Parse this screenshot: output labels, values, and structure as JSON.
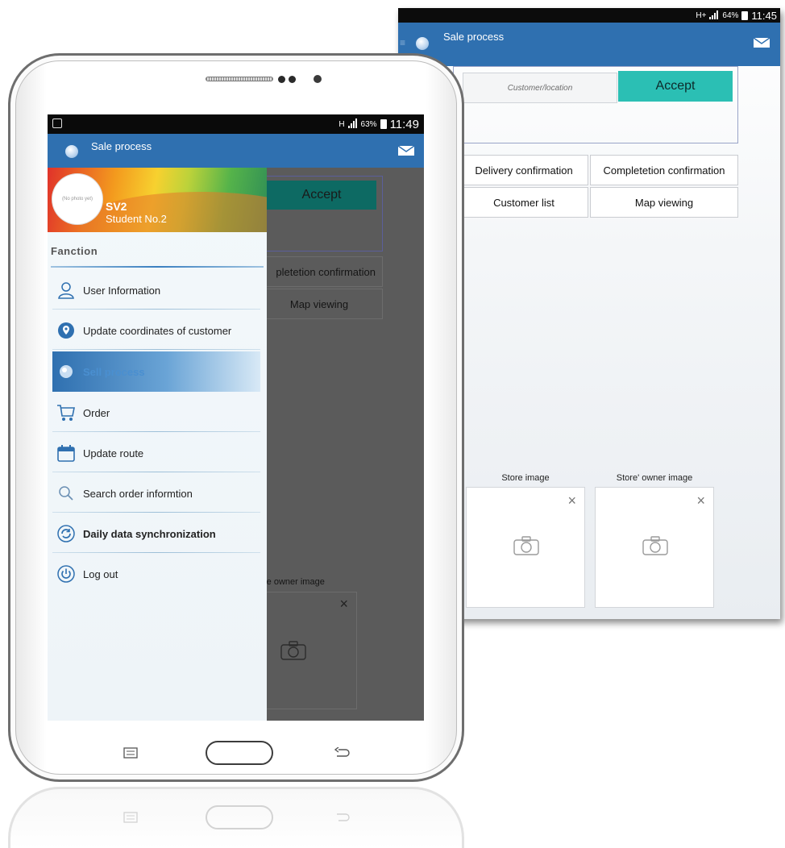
{
  "back_screen": {
    "status": {
      "signal_label": "H+",
      "battery": "64%",
      "time": "11:45"
    },
    "app_title": "Sale process",
    "location_placeholder": "Customer/location",
    "accept_label": "Accept",
    "buttons": [
      {
        "label": "Delivery confirmation"
      },
      {
        "label": "Completetion confirmation"
      },
      {
        "label": "Customer list"
      },
      {
        "label": "Map viewing"
      }
    ],
    "images": [
      {
        "label": "Store image"
      },
      {
        "label": "Store' owner image"
      }
    ],
    "close_glyph": "×"
  },
  "tablet": {
    "status": {
      "signal_label": "H",
      "battery": "63%",
      "time": "11:49"
    },
    "app_title": "Sale process",
    "background": {
      "accept_label": "Accept",
      "btn_completion": "pletetion confirmation",
      "btn_map": "Map viewing",
      "owner_image_label": "re owner image",
      "close_glyph": "×"
    },
    "drawer": {
      "avatar_text": "(No photo yet)",
      "user_name": "SV2",
      "user_id": "Student No.2",
      "section_title": "Fanction",
      "items": [
        {
          "label": "User Information",
          "icon": "user-icon"
        },
        {
          "label": "Update coordinates of customer",
          "icon": "location-pin-icon"
        },
        {
          "label": "Sell process",
          "icon": "sell-process-icon",
          "active": true
        },
        {
          "label": "Order",
          "icon": "cart-icon"
        },
        {
          "label": "Update route",
          "icon": "calendar-icon"
        },
        {
          "label": "Search order informtion",
          "icon": "search-icon"
        },
        {
          "label": "Daily data synchronization",
          "icon": "sync-icon"
        },
        {
          "label": "Log out",
          "icon": "power-icon"
        }
      ]
    }
  },
  "colors": {
    "appbar": "#2f70b0",
    "accept": "#2bbfb4",
    "status_bar": "#0c0c0c",
    "drawer_bg": "#f3f8fb"
  }
}
